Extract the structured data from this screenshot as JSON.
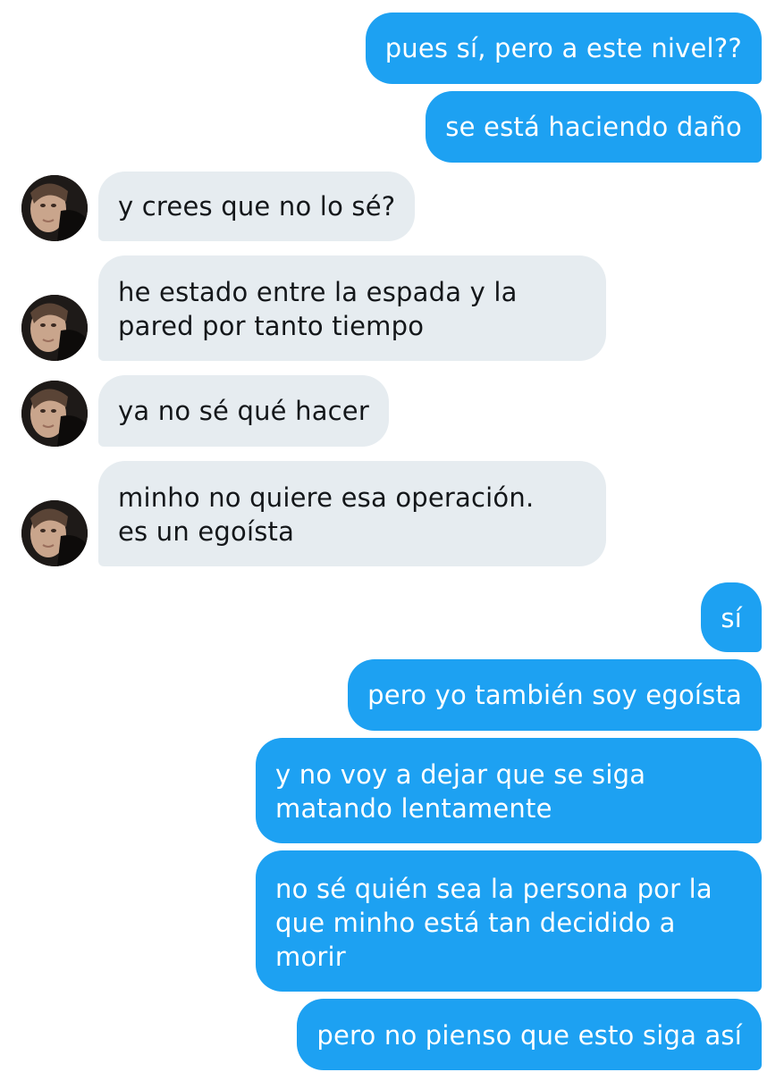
{
  "conversation": {
    "messages": [
      {
        "side": "sent",
        "text": "pues sí, pero a este nivel??"
      },
      {
        "side": "sent",
        "text": "se está haciendo daño"
      },
      {
        "side": "received",
        "text": "y crees que no lo sé?"
      },
      {
        "side": "received",
        "text": "he estado entre la espada y la\npared por tanto tiempo"
      },
      {
        "side": "received",
        "text": "ya no sé qué hacer"
      },
      {
        "side": "received",
        "text": "minho no quiere esa operación.\nes un egoísta"
      },
      {
        "side": "sent",
        "text": "sí"
      },
      {
        "side": "sent",
        "text": "pero yo también soy egoísta"
      },
      {
        "side": "sent",
        "text": "y no voy a dejar que se siga\nmatando lentamente"
      },
      {
        "side": "sent",
        "text": "no sé quién sea la persona por la\nque minho está tan decidido a\nmorir"
      },
      {
        "side": "sent",
        "text": "pero no pienso que esto siga así"
      }
    ]
  },
  "colors": {
    "sent_bubble": "#1da1f2",
    "received_bubble": "#e6ecf0",
    "sent_text": "#ffffff",
    "received_text": "#14171a"
  },
  "icons": {
    "avatar": "contact-avatar-photo"
  }
}
